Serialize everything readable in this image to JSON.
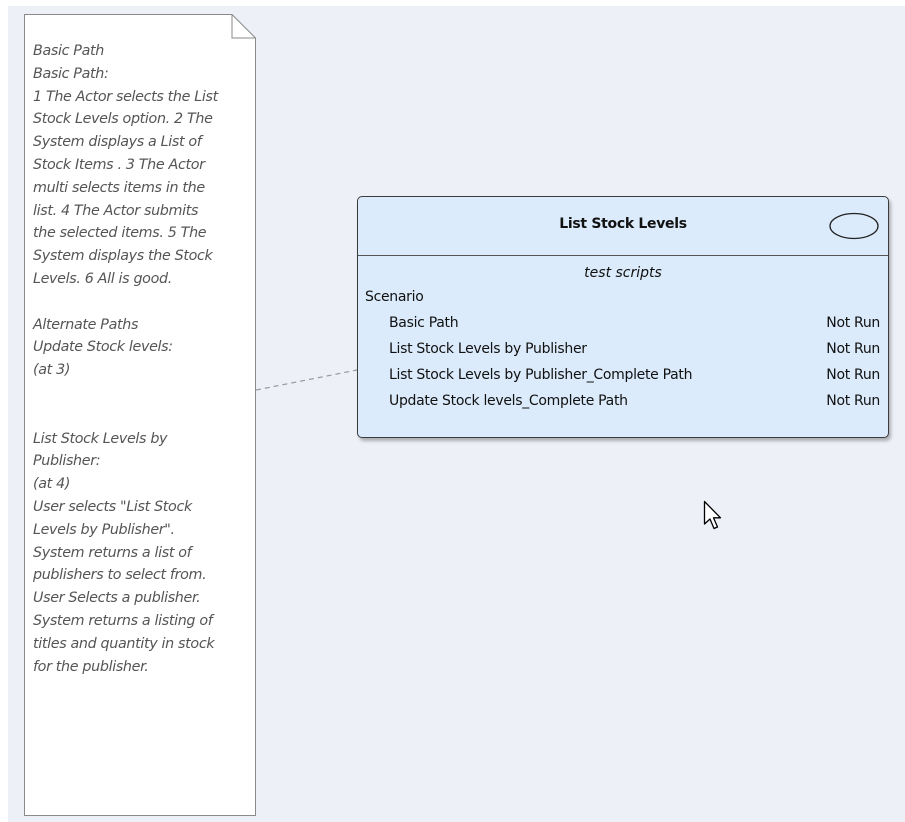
{
  "note": {
    "text": "Basic Path\nBasic Path:\n1 The Actor selects the List\nStock Levels option. 2 The\nSystem displays a List of\nStock Items . 3 The Actor\nmulti selects items in the\nlist. 4 The Actor submits\nthe selected items. 5 The\nSystem displays the Stock\nLevels. 6 All is good.\n\nAlternate Paths\nUpdate Stock levels:\n(at 3)\n\n\nList Stock Levels by\nPublisher:\n(at 4)\nUser selects \"List Stock\nLevels by Publisher\".\nSystem returns a list of\npublishers to select from.\nUser Selects a publisher.\nSystem returns a listing of\ntitles and quantity in stock\nfor the publisher."
  },
  "element": {
    "title": "List Stock Levels",
    "compartment_title": "test scripts",
    "section_label": "Scenario",
    "scripts": [
      {
        "name": "Basic Path",
        "status": "Not Run"
      },
      {
        "name": "List Stock Levels by Publisher",
        "status": "Not Run"
      },
      {
        "name": "List Stock Levels by Publisher_Complete Path",
        "status": "Not Run"
      },
      {
        "name": "Update Stock levels_Complete Path",
        "status": "Not Run"
      }
    ]
  },
  "icons": {
    "usecase": "use-case-ellipse-icon",
    "cursor": "mouse-pointer-icon"
  },
  "colors": {
    "canvas": "#edf0f7",
    "element_fill": "#dbebfb",
    "note_fill": "#ffffff",
    "note_text": "#555555"
  }
}
